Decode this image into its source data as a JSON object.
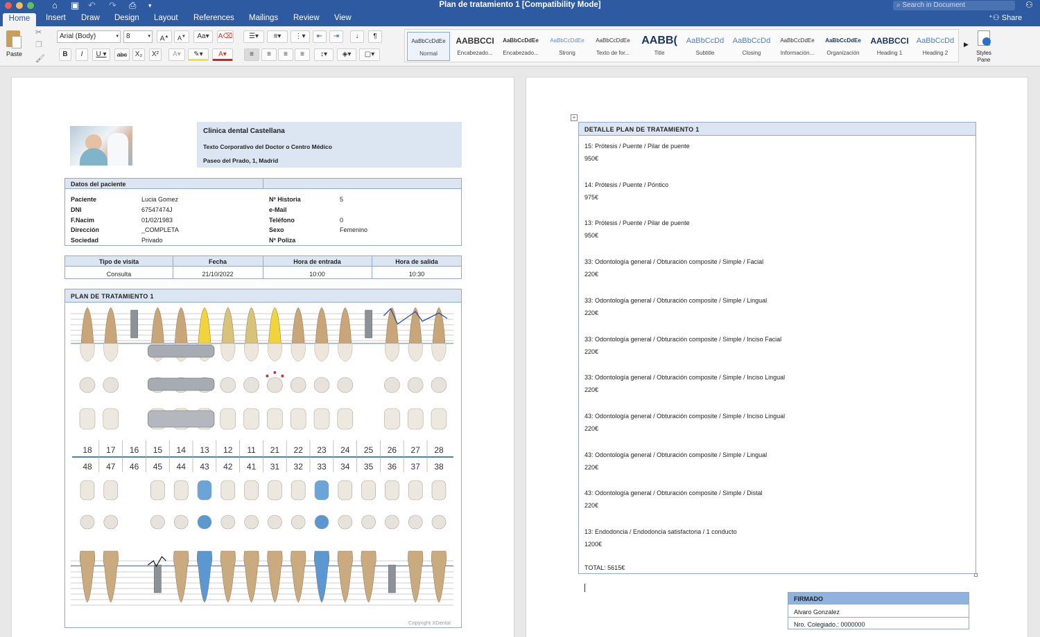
{
  "window": {
    "title": "Plan de tratamiento 1 [Compatibility Mode]",
    "search_placeholder": "Search in Document",
    "share": "Share"
  },
  "tabs": [
    "Home",
    "Insert",
    "Draw",
    "Design",
    "Layout",
    "References",
    "Mailings",
    "Review",
    "View"
  ],
  "ribbon": {
    "paste": "Paste",
    "font_name": "Arial (Body)",
    "font_size": "8",
    "styles_pane": "Styles Pane",
    "styles": [
      {
        "preview": "AaBbCcDdEe",
        "name": "Normal"
      },
      {
        "preview": "AABBCCI",
        "name": "Encabezado..."
      },
      {
        "preview": "AaBbCcDdEe",
        "name": "Encabezado..."
      },
      {
        "preview": "AaBbCcDdEe",
        "name": "Strong"
      },
      {
        "preview": "AaBbCcDdEe",
        "name": "Texto de for..."
      },
      {
        "preview": "AABB(",
        "name": "Title"
      },
      {
        "preview": "AaBbCcDd",
        "name": "Subtitle"
      },
      {
        "preview": "AaBbCcDd",
        "name": "Closing"
      },
      {
        "preview": "AaBbCcDdEe",
        "name": "Información..."
      },
      {
        "preview": "AaBbCcDdEe",
        "name": "Organización"
      },
      {
        "preview": "AABBCCI",
        "name": "Heading 1"
      },
      {
        "preview": "AaBbCcDd",
        "name": "Heading 2"
      }
    ]
  },
  "clinic": {
    "name": "Clinica dental Castellana",
    "tagline": "Texto Corporativo del Doctor o Centro Médico",
    "address": "Paseo del Prado, 1, Madrid"
  },
  "patient": {
    "title": "Datos del paciente",
    "left": [
      {
        "label": "Paciente",
        "value": "Lucia Gomez"
      },
      {
        "label": "DNI",
        "value": "67547474J"
      },
      {
        "label": "F.Nacim",
        "value": "01/02/1983"
      },
      {
        "label": "Dirección",
        "value": "_COMPLETA"
      },
      {
        "label": "Sociedad",
        "value": "Privado"
      }
    ],
    "right": [
      {
        "label": "Nº Historia",
        "value": "5"
      },
      {
        "label": "e-Mail",
        "value": ""
      },
      {
        "label": "Teléfono",
        "value": "0"
      },
      {
        "label": "Sexo",
        "value": "Femenino"
      },
      {
        "label": "Nº Poliza",
        "value": ""
      }
    ]
  },
  "visit": {
    "headers": [
      "Tipo de visita",
      "Fecha",
      "Hora de entrada",
      "Hora de salida"
    ],
    "values": [
      "Consulta",
      "21/10/2022",
      "10:00",
      "10:30"
    ]
  },
  "plan": {
    "title": "PLAN DE TRATAMIENTO 1",
    "upper": [
      "18",
      "17",
      "16",
      "15",
      "14",
      "13",
      "12",
      "11",
      "21",
      "22",
      "23",
      "24",
      "25",
      "26",
      "27",
      "28"
    ],
    "lower": [
      "48",
      "47",
      "46",
      "45",
      "44",
      "43",
      "42",
      "41",
      "31",
      "32",
      "33",
      "34",
      "35",
      "36",
      "37",
      "38"
    ],
    "copyright": "Copyright XDental"
  },
  "detail": {
    "title": "DETALLE PLAN DE TRATAMIENTO 1",
    "items": [
      {
        "desc": "15: Prótesis / Puente / Pilar de puente",
        "price": "950€"
      },
      {
        "desc": "14: Prótesis / Puente / Póntico",
        "price": "975€"
      },
      {
        "desc": "13: Prótesis / Puente / Pilar de puente",
        "price": "950€"
      },
      {
        "desc": "33: Odontología general / Obturación composite / Simple / Facial",
        "price": "220€"
      },
      {
        "desc": "33: Odontología general / Obturación composite / Simple / Lingual",
        "price": "220€"
      },
      {
        "desc": "33: Odontología general / Obturación composite / Simple / Inciso Facial",
        "price": "220€"
      },
      {
        "desc": "33: Odontología general / Obturación composite / Simple / Inciso Lingual",
        "price": "220€"
      },
      {
        "desc": "43: Odontología general / Obturación composite / Simple / Inciso Lingual",
        "price": "220€"
      },
      {
        "desc": "43: Odontología general / Obturación composite / Simple / Lingual",
        "price": "220€"
      },
      {
        "desc": "43: Odontología general / Obturación composite / Simple / Distal",
        "price": "220€"
      },
      {
        "desc": "13: Endodoncia / Endodoncia satisfactoria / 1 conducto",
        "price": "1200€"
      }
    ],
    "total": "TOTAL: 5615€"
  },
  "signed": {
    "title": "FIRMADO",
    "name": "Alvaro Gonzalez",
    "colegiado": "Nro. Colegiado.: 0000000"
  }
}
